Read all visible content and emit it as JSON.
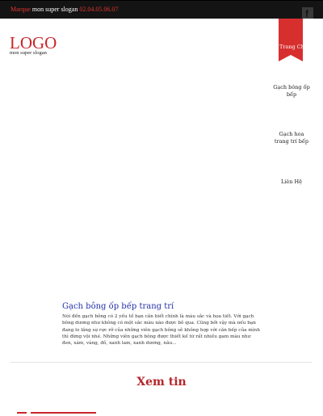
{
  "topbar": {
    "brand": "Marque",
    "slogan": "mon super slogan",
    "phone": "02.04.05.06.07"
  },
  "header": {
    "logo": "LOGO",
    "logo_slogan": "mon super slogan"
  },
  "nav": {
    "active_label": "Trang Chủ",
    "items": [
      {
        "label": "Gạch bông ốp bếp"
      },
      {
        "label": "Gạch hoa trang trí bếp"
      },
      {
        "label": "Liên Hệ"
      }
    ]
  },
  "post": {
    "title": "Gạch bông ốp bếp trang trí",
    "excerpt": "Nói đến gạch bông có 2 yếu tố bạn cần biết chính là màu sắc và họa tiết. Với gạch bông dương như không có một sắc màu nào được bỏ qua. Cũng bởi vậy mà nếu bạn đang lo lắng sự rực rỡ của những viên gạch bông sẽ không hợp với căn bếp của mình thì đừng vội nhé. Những viên gạch bông được thiết kế từ rất nhiều gam màu như đen, xám, vàng, đỏ, xanh lam, xanh dương, nâu...",
    "read_more": "Xem tin"
  },
  "colors": {
    "accent": "#c8262b",
    "topbar": "#141414"
  },
  "icons": {
    "social": "facebook-icon"
  }
}
